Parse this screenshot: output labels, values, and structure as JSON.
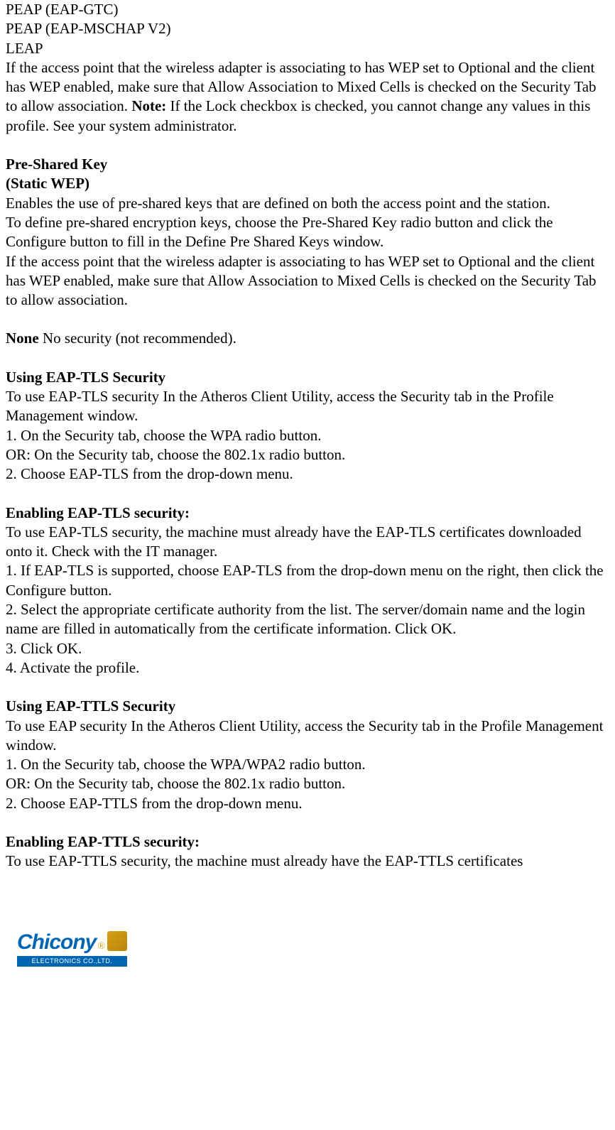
{
  "intro": {
    "line1": "PEAP (EAP-GTC)",
    "line2": "PEAP (EAP-MSCHAP V2)",
    "line3": "LEAP",
    "para1_a": "If the access point that the wireless adapter is associating to has WEP set to Optional and the client has WEP enabled, make sure that Allow Association to Mixed Cells is checked on the Security Tab to allow association. ",
    "para1_note_label": "Note:",
    "para1_b": " If the Lock checkbox is checked, you cannot change any values in this profile. See your system administrator."
  },
  "psk": {
    "heading1": "Pre-Shared Key",
    "heading2": "(Static WEP)",
    "p1": "Enables the use of pre-shared keys that are defined on both the access point and the station.",
    "p2": "To define pre-shared encryption keys, choose the Pre-Shared Key radio button and click the Configure button to fill in the Define Pre Shared Keys window.",
    "p3": "If the access point that the wireless adapter is associating to has WEP set to Optional and the client has WEP enabled, make sure that Allow Association to Mixed Cells is checked on the Security Tab to allow association."
  },
  "none": {
    "label": "None",
    "text": " No security (not recommended)."
  },
  "eap_tls": {
    "heading": "Using EAP-TLS Security",
    "p1": "To use EAP-TLS security In the Atheros Client Utility, access the Security tab in the Profile Management window.",
    "s1": "1. On the Security tab, choose the WPA radio button.",
    "s1b": "OR: On the Security tab, choose the 802.1x radio button.",
    "s2": "2. Choose EAP-TLS from the drop-down menu."
  },
  "eap_tls_enable": {
    "heading": "Enabling EAP-TLS security:",
    "p1": "To use EAP-TLS security, the machine must already have the EAP-TLS certificates downloaded onto it. Check with the IT manager.",
    "s1": "1. If EAP-TLS is supported, choose EAP-TLS from the drop-down menu on the right, then click the Configure button.",
    "s2": "2. Select the appropriate certificate authority from the list. The server/domain name and the login name are filled in automatically from the certificate information. Click OK.",
    "s3": "3. Click OK.",
    "s4": "4. Activate the profile."
  },
  "eap_ttls": {
    "heading": "Using EAP-TTLS Security",
    "p1": "To use EAP security In the Atheros Client Utility, access the Security tab in the Profile Management window.",
    "s1": "1. On the Security tab, choose the WPA/WPA2 radio button.",
    "s1b": "OR: On the Security tab, choose the 802.1x radio button.",
    "s2": "2. Choose EAP-TTLS from the drop-down menu."
  },
  "eap_ttls_enable": {
    "heading": "Enabling EAP-TTLS security:",
    "p1": "To use EAP-TTLS security, the machine must already have the EAP-TTLS certificates"
  },
  "logo": {
    "brand": "Chicony",
    "subtitle": "ELECTRONICS CO.,LTD."
  }
}
